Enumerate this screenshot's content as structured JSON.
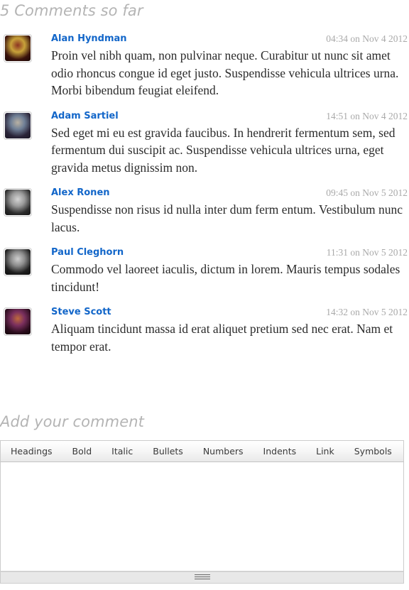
{
  "comments_section": {
    "heading": "5 Comments so far",
    "items": [
      {
        "author": "Alan Hyndman",
        "timestamp": "04:34 on Nov 4 2012",
        "text": "Proin vel nibh quam, non pulvinar neque. Curabitur ut nunc sit amet odio rhoncus congue id eget justo. Suspendisse vehicula ultrices urna. Morbi bibendum feugiat eleifend.",
        "avatar_name": "avatar-alan-hyndman",
        "avatar_colors": [
          "#3a120c",
          "#c8a23a",
          "#8d3522",
          "#1a0805"
        ]
      },
      {
        "author": "Adam Sartiel",
        "timestamp": "14:51 on Nov 4 2012",
        "text": "Sed eget mi eu est gravida faucibus. In hendrerit fermentum sem, sed fermentum dui suscipit ac. Suspendisse vehicula ultrices urna, eget gravida metus dignissim non.",
        "avatar_name": "avatar-adam-sartiel",
        "avatar_colors": [
          "#2a2438",
          "#6f7f96",
          "#b9b1a3",
          "#1b1724"
        ]
      },
      {
        "author": "Alex Ronen",
        "timestamp": "09:45 on Nov 5 2012",
        "text": "Suspendisse non risus id nulla inter dum ferm entum. Vestibulum nunc lacus.",
        "avatar_name": "avatar-alex-ronen",
        "avatar_colors": [
          "#2c2c2c",
          "#9a9a9a",
          "#d5d5d5",
          "#141414"
        ]
      },
      {
        "author": "Paul Cleghorn",
        "timestamp": "11:31 on Nov 5 2012",
        "text": "Commodo vel laoreet iaculis, dictum in lorem. Mauris tempus sodales tincidunt!",
        "avatar_name": "avatar-paul-cleghorn",
        "avatar_colors": [
          "#1f1f1f",
          "#8c8c8c",
          "#cfcfcf",
          "#0d0d0d"
        ]
      },
      {
        "author": "Steve Scott",
        "timestamp": "14:32 on Nov 5 2012",
        "text": "Aliquam tincidunt massa id erat aliquet pretium sed nec erat. Nam et tempor erat.",
        "avatar_name": "avatar-steve-scott",
        "avatar_colors": [
          "#2b0d1d",
          "#7a2f5e",
          "#c06a3c",
          "#120509"
        ]
      }
    ]
  },
  "add_comment": {
    "heading": "Add your comment",
    "toolbar": {
      "buttons": [
        {
          "label": "Headings",
          "name": "toolbar-headings-button"
        },
        {
          "label": "Bold",
          "name": "toolbar-bold-button"
        },
        {
          "label": "Italic",
          "name": "toolbar-italic-button"
        },
        {
          "label": "Bullets",
          "name": "toolbar-bullets-button"
        },
        {
          "label": "Numbers",
          "name": "toolbar-numbers-button"
        },
        {
          "label": "Indents",
          "name": "toolbar-indents-button"
        },
        {
          "label": "Link",
          "name": "toolbar-link-button"
        },
        {
          "label": "Symbols",
          "name": "toolbar-symbols-button"
        }
      ]
    },
    "textarea": {
      "value": "",
      "placeholder": ""
    },
    "resize_grip_icon": "resize-grip-icon"
  },
  "colors": {
    "author_link": "#1266c9",
    "heading_gray": "#b4b4b4",
    "timestamp_gray": "#a9a9a9",
    "body_text": "#2b2b2b",
    "toolbar_border": "#cccccc",
    "footer_bg": "#e8e8e8"
  }
}
